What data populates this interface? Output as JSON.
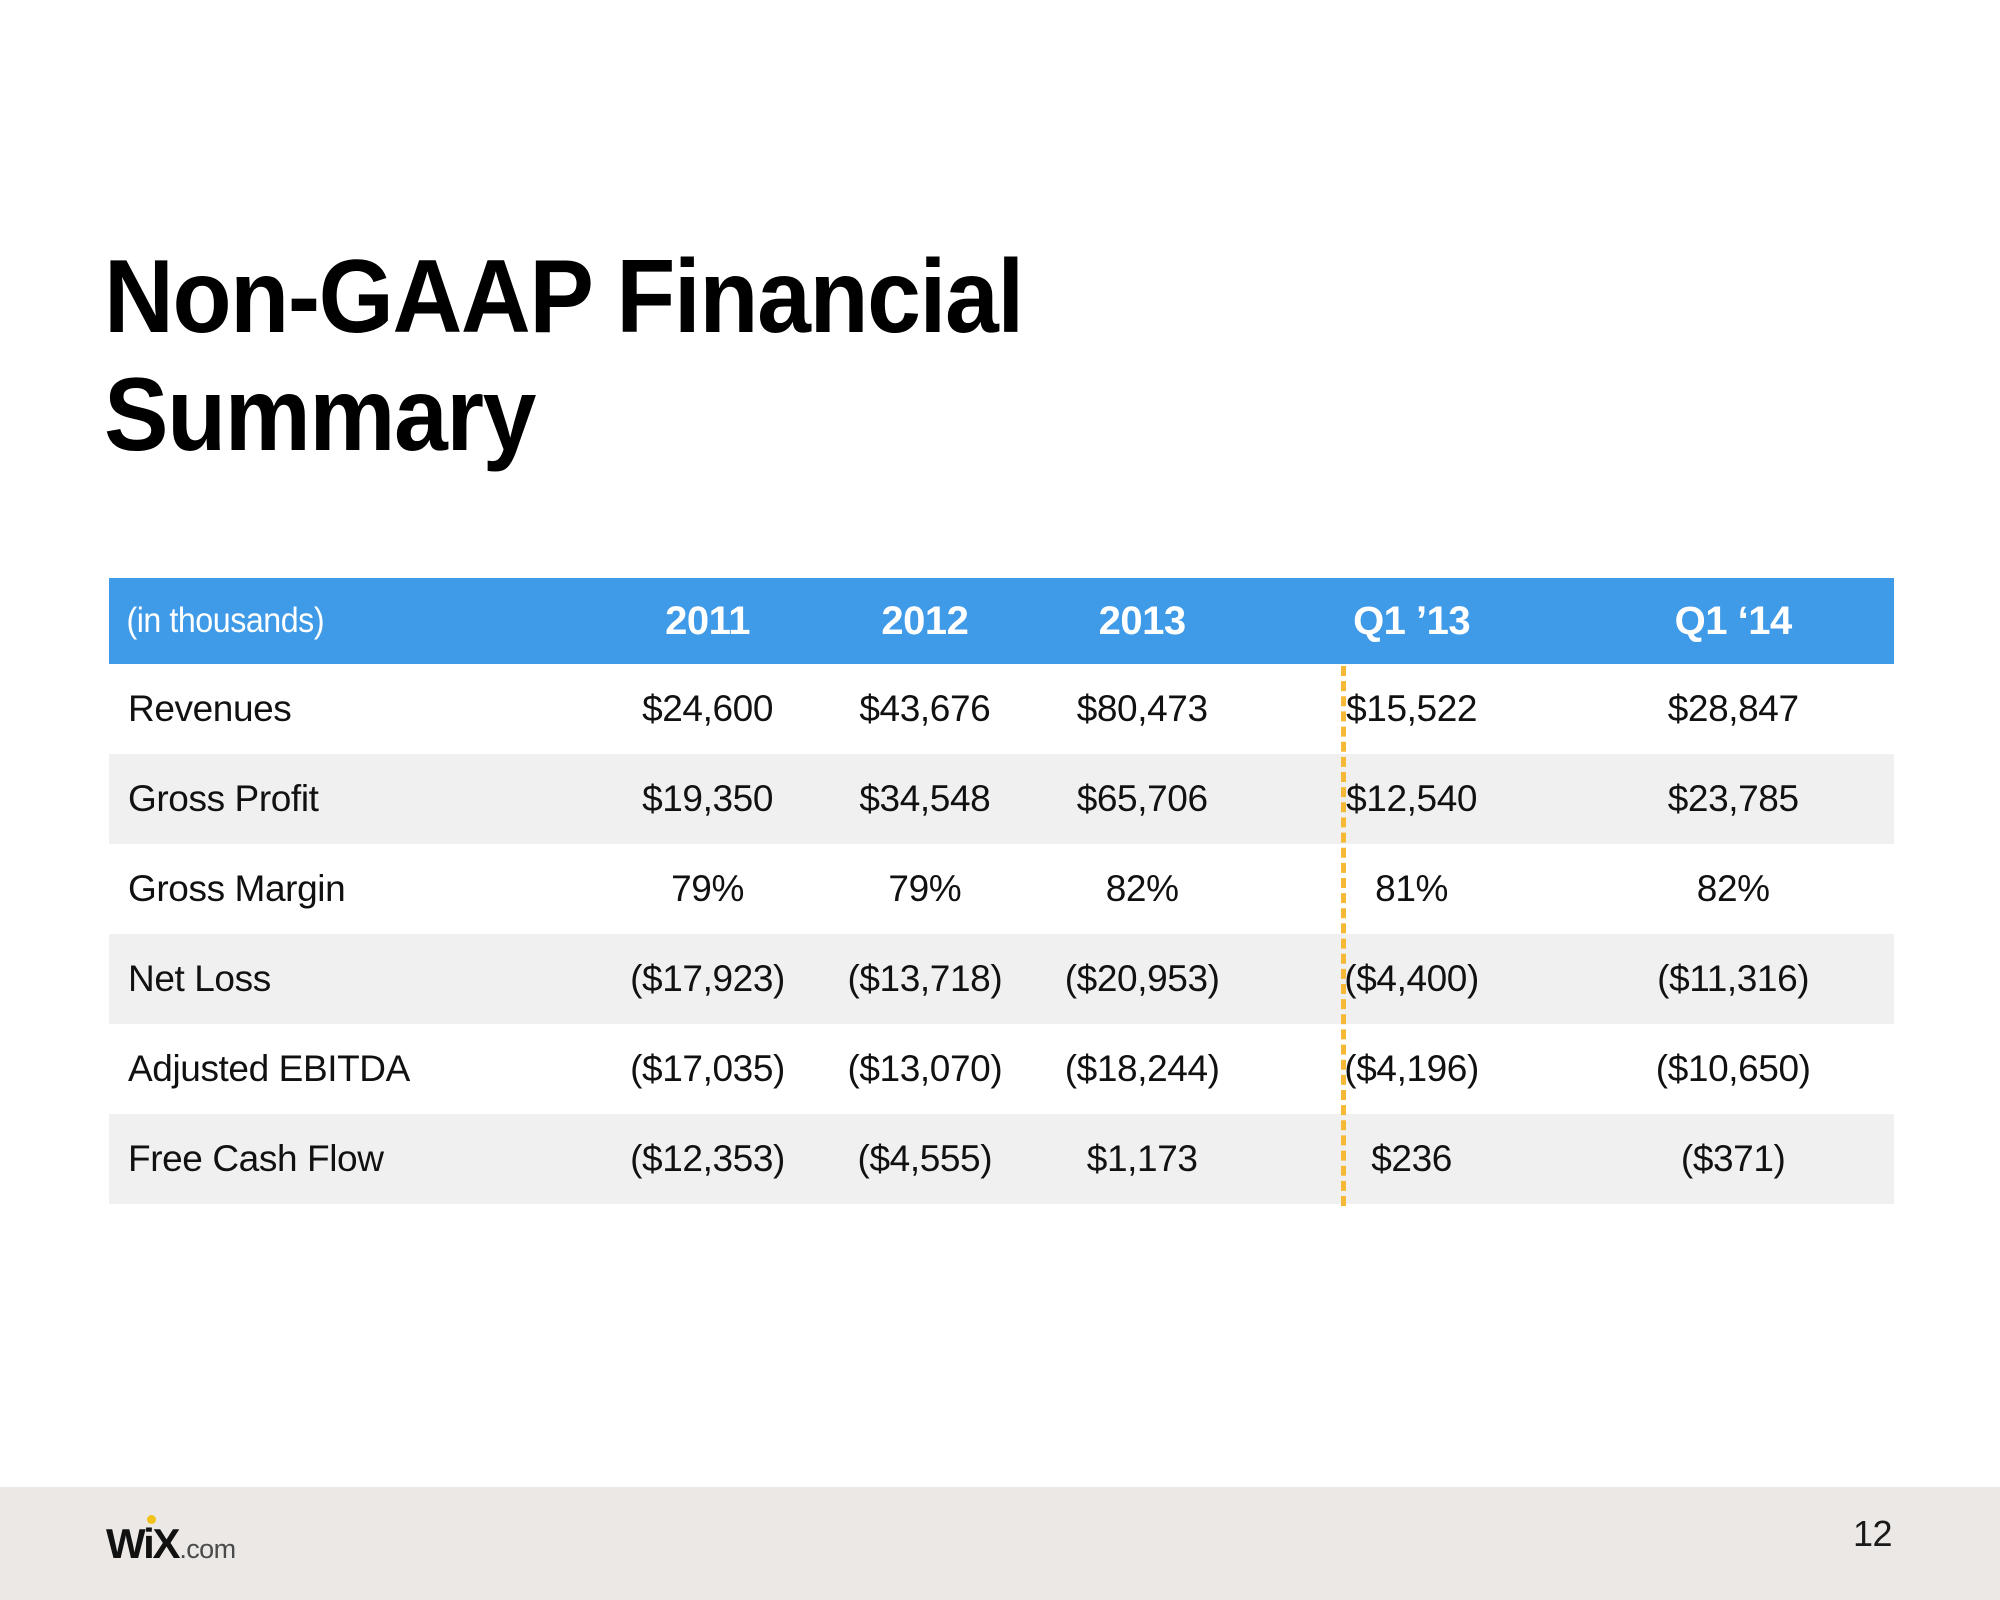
{
  "slide": {
    "title": "Non-GAAP Financial\nSummary",
    "page_number": "12",
    "colors": {
      "header_blue": "#3f9ae8",
      "alt_row_gray": "#f0f0f0",
      "divider_orange": "#f5b935",
      "footer_gray": "#ebe8e5",
      "logo_dot_yellow": "#f2c31a"
    }
  },
  "table": {
    "unit_label": "(in thousands)",
    "columns": [
      "2011",
      "2012",
      "2013",
      "Q1 ’13",
      "Q1 ‘14"
    ],
    "rows": [
      {
        "label": "Revenues",
        "values": [
          "$24,600",
          "$43,676",
          "$80,473",
          "$15,522",
          "$28,847"
        ]
      },
      {
        "label": "Gross Profit",
        "values": [
          "$19,350",
          "$34,548",
          "$65,706",
          "$12,540",
          "$23,785"
        ]
      },
      {
        "label": "Gross Margin",
        "values": [
          "79%",
          "79%",
          "82%",
          "81%",
          "82%"
        ]
      },
      {
        "label": "Net Loss",
        "values": [
          "($17,923)",
          "($13,718)",
          "($20,953)",
          "($4,400)",
          "($11,316)"
        ]
      },
      {
        "label": "Adjusted EBITDA",
        "values": [
          "($17,035)",
          "($13,070)",
          "($18,244)",
          "($4,196)",
          "($10,650)"
        ]
      },
      {
        "label": "Free Cash Flow",
        "values": [
          "($12,353)",
          "($4,555)",
          "$1,173",
          "$236",
          "($371)"
        ]
      }
    ]
  },
  "footer": {
    "logo_mark": "WiX",
    "logo_suffix": ".com"
  }
}
